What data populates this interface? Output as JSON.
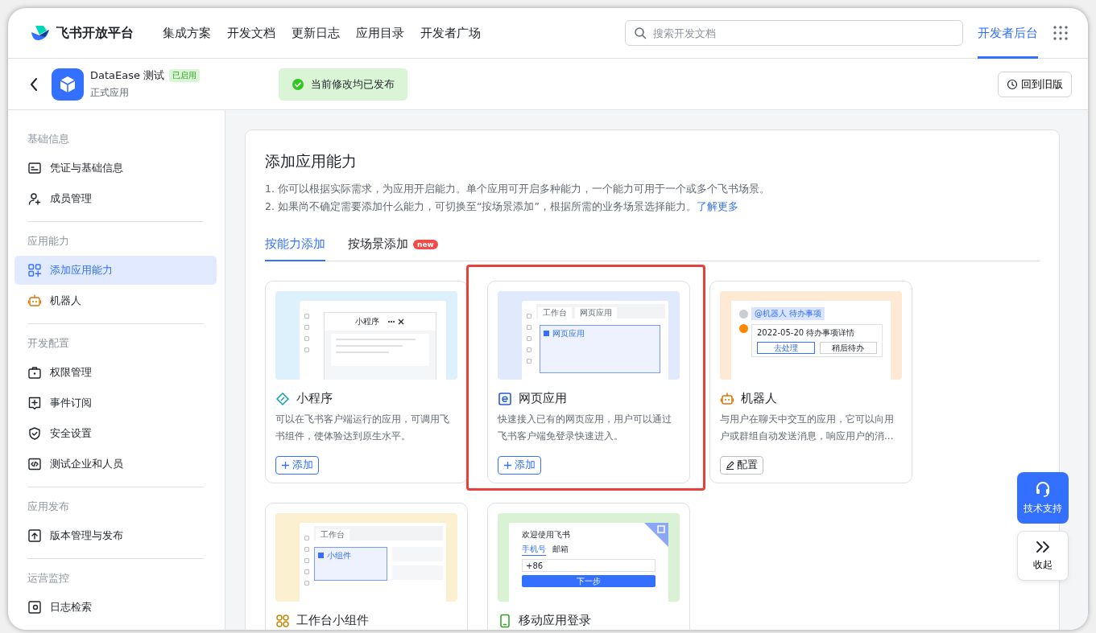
{
  "topnav": {
    "brand": "飞书开放平台",
    "items": [
      {
        "label": "集成方案"
      },
      {
        "label": "开发文档"
      },
      {
        "label": "更新日志"
      },
      {
        "label": "应用目录"
      },
      {
        "label": "开发者广场"
      }
    ],
    "search": {
      "placeholder": "搜索开发文档"
    },
    "console": {
      "label": "开发者后台",
      "selected": true
    }
  },
  "app_header": {
    "name": "DataEase 测试",
    "status": "已启用",
    "type": "正式应用",
    "notice": "当前修改均已发布",
    "legacy_button": "回到旧版"
  },
  "sidebar": {
    "sections": [
      {
        "title": "基础信息",
        "items": [
          {
            "kind": "credential",
            "label": "凭证与基础信息",
            "selected": false
          },
          {
            "kind": "members",
            "label": "成员管理",
            "selected": false
          }
        ]
      },
      {
        "title": "应用能力",
        "items": [
          {
            "kind": "capability",
            "label": "添加应用能力",
            "selected": true
          },
          {
            "kind": "bot",
            "label": "机器人",
            "selected": false
          }
        ]
      },
      {
        "title": "开发配置",
        "items": [
          {
            "kind": "permission",
            "label": "权限管理",
            "selected": false
          },
          {
            "kind": "event",
            "label": "事件订阅",
            "selected": false
          },
          {
            "kind": "security",
            "label": "安全设置",
            "selected": false
          },
          {
            "kind": "test",
            "label": "测试企业和人员",
            "selected": false
          }
        ]
      },
      {
        "title": "应用发布",
        "items": [
          {
            "kind": "release",
            "label": "版本管理与发布",
            "selected": false
          }
        ]
      },
      {
        "title": "运营监控",
        "items": [
          {
            "kind": "log",
            "label": "日志检索",
            "selected": false
          }
        ]
      }
    ]
  },
  "panel": {
    "title": "添加应用能力",
    "notes": [
      "1. 你可以根据实际需求，为应用开启能力。单个应用可开启多种能力，一个能力可用于一个或多个飞书场景。",
      "2. 如果尚不确定需要添加什么能力，可切换至“按场景添加”，根据所需的业务场景选择能力。"
    ],
    "link": "了解更多",
    "tabs": [
      {
        "label": "按能力添加",
        "selected": true
      },
      {
        "label": "按场景添加",
        "badge": "new",
        "selected": false
      }
    ],
    "cards": [
      {
        "kind": "miniprogram",
        "highlighted": false,
        "title": "小程序",
        "description": "可以在飞书客户端运行的应用，可调用飞书组件，使体验达到原生水平。",
        "action": {
          "kind": "add",
          "label": "添加"
        },
        "preview": {
          "window_title": "小程序"
        }
      },
      {
        "kind": "webapp",
        "highlighted": true,
        "title": "网页应用",
        "description": "快速接入已有的网页应用，用户可以通过飞书客户端免登录快速进入。",
        "action": {
          "kind": "add",
          "label": "添加"
        },
        "preview": {
          "tabs": [
            "工作台",
            "网页应用"
          ],
          "content_label": "网页应用"
        }
      },
      {
        "kind": "bot",
        "highlighted": false,
        "title": "机器人",
        "description": "与用户在聊天中交互的应用，它可以向用户或群组自动发送消息，响应用户的消...",
        "action": {
          "kind": "configure",
          "label": "配置"
        },
        "preview": {
          "chip": "@机器人 待办事项",
          "message": "2022-05-20 待办事项详情",
          "buttons": [
            "去处理",
            "稍后待办"
          ]
        }
      },
      {
        "kind": "widget",
        "highlighted": false,
        "title": "工作台小组件",
        "preview": {
          "tabs": [
            "工作台"
          ],
          "content_label": "小组件"
        }
      },
      {
        "kind": "mobile_login",
        "highlighted": false,
        "title": "移动应用登录",
        "preview": {
          "heading": "欢迎使用飞书",
          "tabs": [
            "手机号",
            "邮箱"
          ],
          "country": "+86",
          "button": "下一步"
        }
      }
    ]
  },
  "support": {
    "help": "技术支持",
    "collapse": "收起"
  }
}
